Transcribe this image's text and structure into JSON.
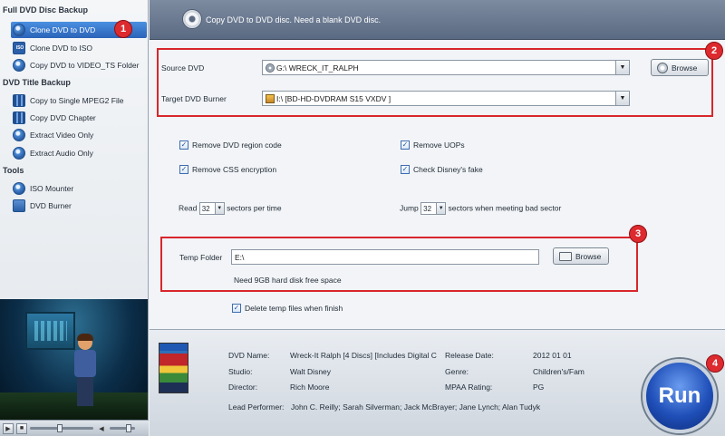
{
  "sidebar": {
    "sections": [
      {
        "title": "Full DVD Disc Backup"
      },
      {
        "title": "DVD Title Backup"
      },
      {
        "title": "Tools"
      }
    ],
    "items": [
      {
        "label": "Clone DVD to DVD"
      },
      {
        "label": "Clone DVD to ISO"
      },
      {
        "label": "Copy DVD to VIDEO_TS Folder"
      },
      {
        "label": "Copy to Single MPEG2 File"
      },
      {
        "label": "Copy DVD Chapter"
      },
      {
        "label": "Extract Video Only"
      },
      {
        "label": "Extract Audio Only"
      },
      {
        "label": "ISO Mounter"
      },
      {
        "label": "DVD Burner"
      }
    ]
  },
  "header": {
    "text": "Copy DVD to DVD disc. Need a blank DVD disc."
  },
  "source": {
    "label": "Source DVD",
    "value": "G:\\ WRECK_IT_RALPH",
    "browse_label": "Browse"
  },
  "target": {
    "label": "Target DVD Burner",
    "value": "I:\\ [BD-HD-DVDRAM S15 VXDV    ]"
  },
  "options": {
    "remove_region": "Remove DVD region code",
    "remove_css": "Remove CSS encryption",
    "remove_uops": "Remove UOPs",
    "check_disney": "Check Disney's fake",
    "read_prefix": "Read",
    "read_value": "32",
    "read_suffix": "sectors per time",
    "jump_prefix": "Jump",
    "jump_value": "32",
    "jump_suffix": "sectors when meeting bad sector"
  },
  "temp": {
    "label": "Temp Folder",
    "value": "E:\\",
    "browse_label": "Browse",
    "note": "Need 9GB hard disk free space",
    "delete_label": "Delete temp files when finish"
  },
  "badges": [
    "1",
    "2",
    "3",
    "4"
  ],
  "info": {
    "dvd_name_label": "DVD Name:",
    "dvd_name_value": "Wreck-It Ralph [4 Discs] [Includes Digital C",
    "studio_label": "Studio:",
    "studio_value": "Walt Disney",
    "director_label": "Director:",
    "director_value": "Rich Moore",
    "release_label": "Release Date:",
    "release_value": "2012 01 01",
    "genre_label": "Genre:",
    "genre_value": "Children's/Fam",
    "mpaa_label": "MPAA Rating:",
    "mpaa_value": "PG",
    "lead_label": "Lead Performer:",
    "lead_value": "John C. Reilly; Sarah Silverman; Jack McBrayer; Jane Lynch; Alan Tudyk"
  },
  "run_label": "Run",
  "colors": {
    "accent": "#2a63b8",
    "callout": "#d8262c",
    "header": "#6b7a90"
  }
}
